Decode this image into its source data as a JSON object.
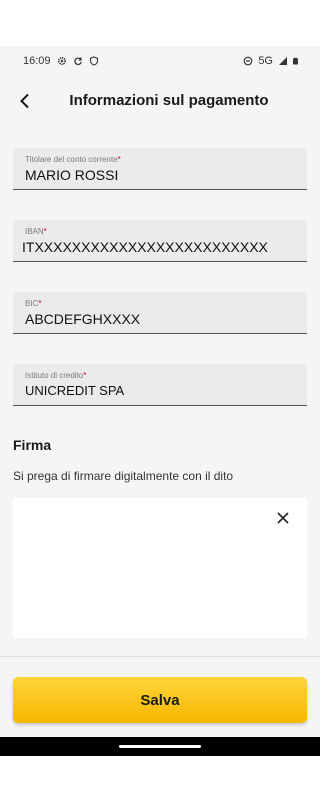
{
  "status_bar": {
    "time": "16:09",
    "network": "5G",
    "left_icons": [
      "gear-icon",
      "sync-icon",
      "shield-icon"
    ],
    "right_icons": [
      "dnd-icon",
      "signal-icon",
      "battery-icon"
    ]
  },
  "header": {
    "title": "Informazioni sul pagamento",
    "back_icon": "chevron-left-icon"
  },
  "form": {
    "holder": {
      "label": "Titolare del conto corrente",
      "required_mark": "*",
      "value": "MARIO ROSSI"
    },
    "iban": {
      "label": "IBAN",
      "required_mark": "*",
      "value": "ITXXXXXXXXXXXXXXXXXXXXXXXXX"
    },
    "bic": {
      "label": "BIC",
      "required_mark": "*",
      "value": "ABCDEFGHXXXX"
    },
    "bank": {
      "label": "Istituto di credito",
      "required_mark": "*",
      "value": "UNICREDIT SPA"
    }
  },
  "signature": {
    "title": "Firma",
    "instruction": "Si prega di firmare digitalmente con il dito",
    "clear_icon": "close-icon"
  },
  "footer": {
    "save_label": "Salva"
  },
  "colors": {
    "accent": "#f9c21a",
    "required": "#d0021b",
    "field_bg": "#ebebee",
    "screen_bg": "#f5f5f5"
  }
}
